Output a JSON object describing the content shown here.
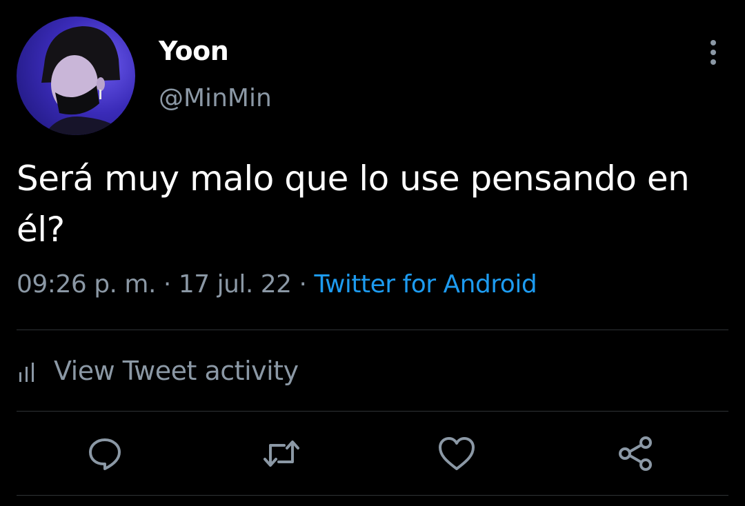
{
  "user": {
    "display_name": "Yoon",
    "handle": "@MinMin"
  },
  "tweet": {
    "text": "Será muy malo que lo use pensando en él?",
    "time": "09:26 p. m.",
    "separator": "·",
    "date": "17 jul. 22",
    "source": "Twitter for Android"
  },
  "activity": {
    "label": "View Tweet activity"
  },
  "icons": {
    "more": "more-vertical-icon",
    "activity": "bar-chart-icon",
    "reply": "reply-icon",
    "retweet": "retweet-icon",
    "like": "heart-icon",
    "share": "share-icon"
  },
  "colors": {
    "background": "#000000",
    "primary_text": "#ffffff",
    "secondary_text": "#8b98a5",
    "link": "#1d9bf0",
    "divider": "#2f3336"
  }
}
